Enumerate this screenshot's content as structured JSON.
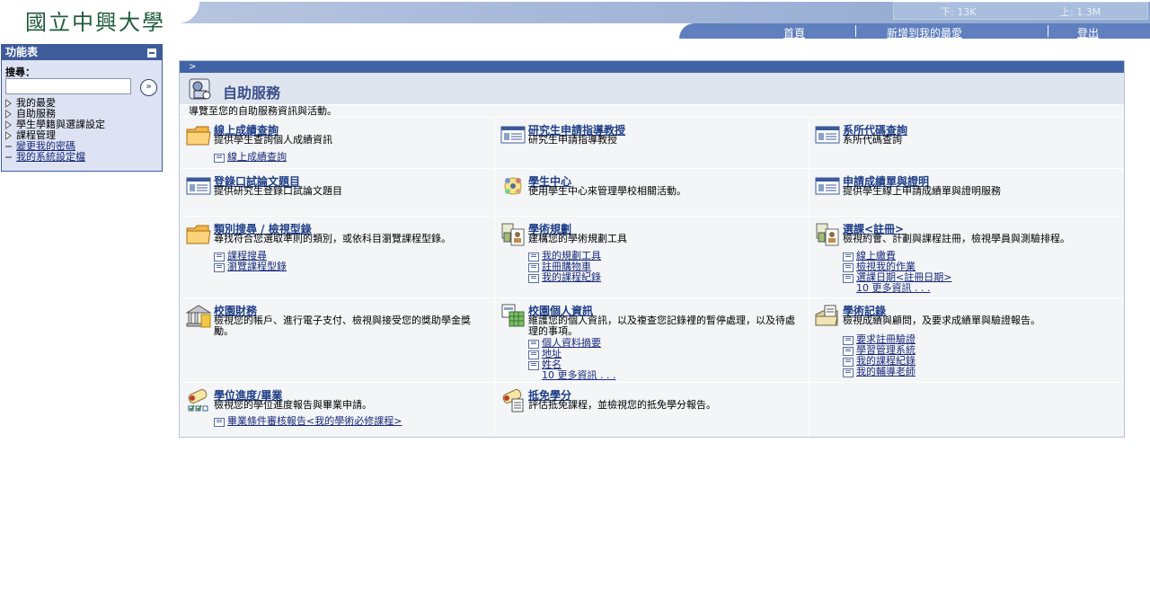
{
  "header": {
    "logo_text": "國立中興大學",
    "meter_down": "下: 13K",
    "meter_up": "上: 1.3M",
    "links": [
      "首頁",
      "新增到我的最愛",
      "登出"
    ]
  },
  "menu": {
    "title": "功能表",
    "search_label": "搜尋：",
    "search_value": "",
    "items": [
      {
        "label": "我的最愛",
        "kind": "folder"
      },
      {
        "label": "自助服務",
        "kind": "folder"
      },
      {
        "label": "學生學籍與選課設定",
        "kind": "folder"
      },
      {
        "label": "課程管理",
        "kind": "folder"
      },
      {
        "label": "變更我的密碼",
        "kind": "link"
      },
      {
        "label": "我的系統設定檔",
        "kind": "link"
      }
    ]
  },
  "panel": {
    "breadcrumb": ">",
    "title": "自助服務",
    "description": "導覽至您的自助服務資訊與活動。",
    "cells": [
      {
        "title": "線上成績查詢",
        "desc": "提供學生查詢個人成績資訊",
        "links": [
          "線上成績查詢"
        ],
        "icon": "folder-icon"
      },
      {
        "title": "研究生申請指導教授",
        "desc": "研究生申請指導教授",
        "links": [],
        "icon": "window-icon"
      },
      {
        "title": "系所代碼查詢",
        "desc": "系所代碼查詢",
        "links": [],
        "icon": "window-icon"
      },
      {
        "title": "登錄口試論文題目",
        "desc": "提供研究生登錄口試論文題目",
        "links": [],
        "icon": "window-icon"
      },
      {
        "title": "學生中心",
        "desc": "使用學生中心來管理學校相關活動。",
        "links": [],
        "icon": "people-icon"
      },
      {
        "title": "申請成績單與證明",
        "desc": "提供學生線上申請成績單與證明服務",
        "links": [],
        "icon": "window-icon"
      },
      {
        "title": "類別搜尋 / 檢視型錄",
        "desc": "尋找符合您選取準則的類別，或依科目瀏覽課程型錄。",
        "links": [
          "課程搜尋",
          "瀏覽課程型錄"
        ],
        "icon": "folder-icon"
      },
      {
        "title": "學術規劃",
        "desc": "建構您的學術規劃工具",
        "links": [
          "我的規劃工具",
          "註冊購物車",
          "我的課程紀錄"
        ],
        "icon": "planner-icon"
      },
      {
        "title": "選課<註冊>",
        "desc": "檢視約會、計劃與課程註冊，檢視學員與測驗排程。",
        "links": [
          "線上繳費",
          "檢視我的作業",
          "選課日期<註冊日期>"
        ],
        "more": "10 更多資訊 . . .",
        "icon": "planner-icon"
      },
      {
        "title": "校園財務",
        "desc": "檢視您的帳戶、進行電子支付、檢視與接受您的獎助學金獎勵。",
        "links": [],
        "icon": "finance-icon"
      },
      {
        "title": "校園個人資訊",
        "desc": "維護您的個人資訊，以及複查您記錄裡的暫停處理，以及待處理的事項。",
        "links": [
          "個人資料摘要",
          "地址",
          "姓名"
        ],
        "more": "10 更多資訊 . . .",
        "icon": "personal-icon"
      },
      {
        "title": "學術記錄",
        "desc": "檢視成績與顧問，及要求成績單與驗證報告。",
        "links": [
          "要求註冊驗證",
          "學習管理系統",
          "我的課程紀錄",
          "我的輔導老師"
        ],
        "icon": "records-icon"
      },
      {
        "title": "學位進度/畢業",
        "desc": "檢視您的學位進度報告與畢業申請。",
        "links": [
          "畢業條件審核報告<我的學術必修課程>"
        ],
        "icon": "diploma-icon"
      },
      {
        "title": "抵免學分",
        "desc": "評估抵免課程，並檢視您的抵免學分報告。",
        "links": [],
        "icon": "diploma-icon"
      }
    ]
  }
}
